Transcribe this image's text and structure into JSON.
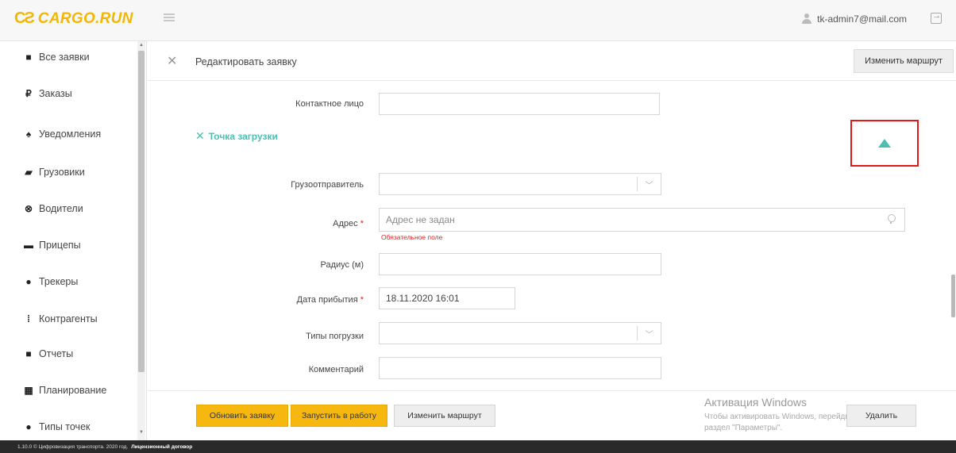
{
  "brand": {
    "name": "CARGO.RUN",
    "mark": "CƧ",
    "color": "#f2b705",
    "accent": "#4cbfb2"
  },
  "header": {
    "user_email": "tk-admin7@mail.com"
  },
  "sidebar": {
    "items": [
      {
        "label": "Все заявки",
        "icon": "■"
      },
      {
        "label": "Заказы",
        "icon": "₽"
      },
      {
        "label": "Уведомления",
        "icon": "♠"
      },
      {
        "label": "Грузовики",
        "icon": "▰"
      },
      {
        "label": "Водители",
        "icon": "⊗"
      },
      {
        "label": "Прицепы",
        "icon": "▬"
      },
      {
        "label": "Трекеры",
        "icon": "●"
      },
      {
        "label": "Контрагенты",
        "icon": "⁞"
      },
      {
        "label": "Отчеты",
        "icon": "■"
      },
      {
        "label": "Планирование",
        "icon": "▦"
      },
      {
        "label": "Типы точек",
        "icon": "●"
      }
    ]
  },
  "edit": {
    "title": "Редактировать заявку",
    "change_route_top": "Изменить маршрут",
    "contact_label": "Контактное лицо",
    "contact_value": "",
    "section_label": "Точка загрузки",
    "shipper_label": "Грузоотправитель",
    "shipper_value": "",
    "address_label": "Адрес",
    "address_placeholder": "Адрес не задан",
    "address_error": "Обязательное поле",
    "radius_label": "Радиус (м)",
    "radius_value": "",
    "arrival_label": "Дата прибытия",
    "arrival_value": "18.11.2020 16:01",
    "loading_types_label": "Типы погрузки",
    "loading_types_value": "",
    "comment_label": "Комментарий",
    "comment_value": ""
  },
  "actions": {
    "update": "Обновить заявку",
    "start": "Запустить в работу",
    "change_route": "Изменить маршрут",
    "delete": "Удалить"
  },
  "windows": {
    "title": "Активация Windows",
    "line1": "Чтобы активировать Windows, перейдите в",
    "line2": "раздел \"Параметры\"."
  },
  "status": {
    "text": "1.10.0 © Цифровизация транспорта. 2020 год.",
    "link": "Лицензионный договор"
  }
}
